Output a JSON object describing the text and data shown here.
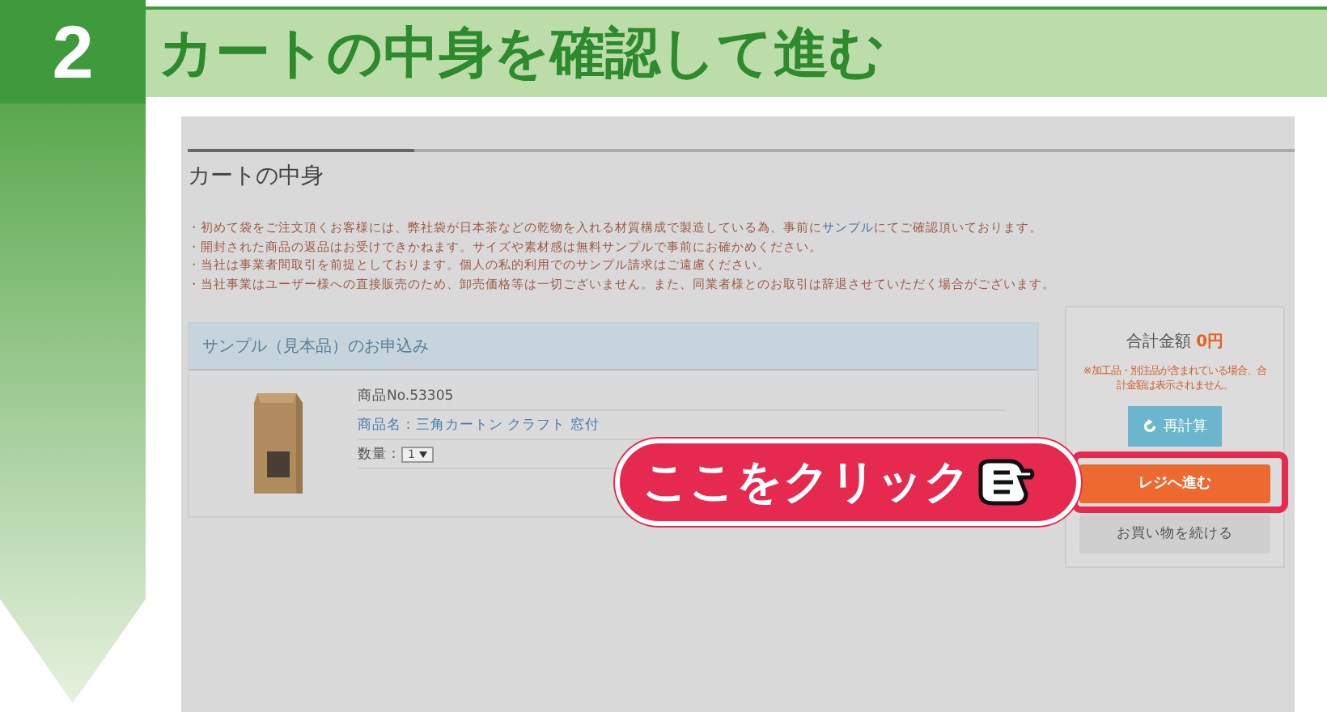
{
  "step": {
    "number": "2",
    "title": "カートの中身を確認して進む"
  },
  "page": {
    "heading": "カートの中身",
    "notes": [
      {
        "parts": [
          {
            "kind": "text",
            "text": "・初めて袋をご注文頂くお客様には、弊社袋が日本茶などの乾物を入れる材質構成で製造している為、事前に"
          },
          {
            "kind": "link",
            "text": "サンプル"
          },
          {
            "kind": "text",
            "text": "にてご確認頂いております。"
          }
        ]
      },
      {
        "parts": [
          {
            "kind": "text",
            "text": "・開封された商品の返品はお受けできかねます。サイズや素材感は無料サンプルで事前にお確かめください。"
          }
        ]
      },
      {
        "parts": [
          {
            "kind": "text",
            "text": "・当社は事業者間取引を前提としております。個人の私的利用でのサンプル請求はご遠慮ください。"
          }
        ]
      },
      {
        "parts": [
          {
            "kind": "text",
            "text": "・当社事業はユーザー様への直接販売のため、卸売価格等は一切ございません。また、同業者様とのお取引は辞退させていただく場合がございます。"
          }
        ]
      }
    ],
    "cart": {
      "title": "サンプル（見本品）のお申込み",
      "item": {
        "code": "商品No.53305",
        "name_label": "商品名：",
        "name": "三角カートン クラフト 窓付",
        "qty_label": "数量：",
        "qty": "1"
      }
    },
    "summary": {
      "total_label": "合計金額",
      "total": "0円",
      "notice": "※加工品・別注品が含まれている場合、合計金額は表示されません。",
      "recalc": "再計算",
      "checkout": "レジへ進む",
      "continue": "お買い物を続ける"
    }
  },
  "callout": {
    "text": "ここをクリック"
  }
}
